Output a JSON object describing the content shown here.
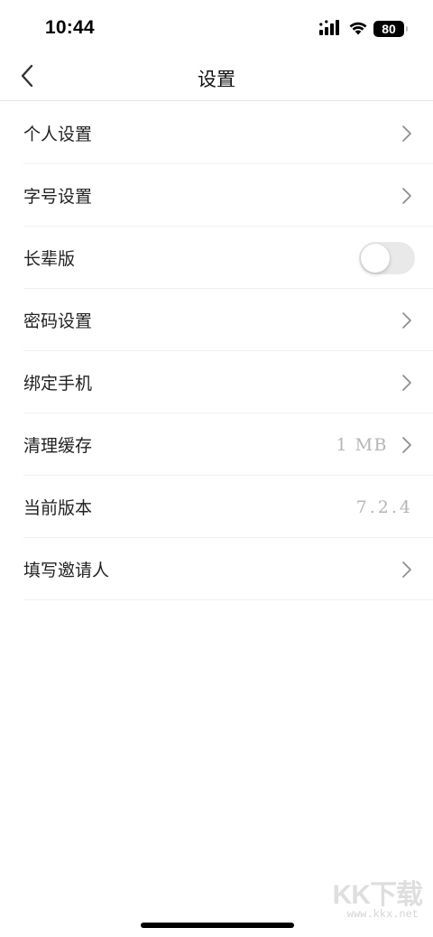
{
  "status_bar": {
    "time": "10:44",
    "battery_level": "80",
    "icons": [
      "cellular-signal-icon",
      "wifi-icon",
      "battery-icon"
    ]
  },
  "nav": {
    "title": "设置",
    "back_icon": "chevron-left-icon"
  },
  "settings": {
    "items": [
      {
        "label": "个人设置",
        "type": "link"
      },
      {
        "label": "字号设置",
        "type": "link"
      },
      {
        "label": "长辈版",
        "type": "toggle",
        "toggle_on": false
      },
      {
        "label": "密码设置",
        "type": "link"
      },
      {
        "label": "绑定手机",
        "type": "link"
      },
      {
        "label": "清理缓存",
        "type": "link",
        "value": "1 MB"
      },
      {
        "label": "当前版本",
        "type": "value",
        "value": "7.2.4"
      },
      {
        "label": "填写邀请人",
        "type": "link"
      }
    ]
  },
  "colors": {
    "background": "#ffffff",
    "text": "#222222",
    "secondary_text": "#b5b5b5",
    "toggle_off": "#e9e9ea",
    "divider": "#f0f0f0"
  },
  "watermark": {
    "logo": "KK下载",
    "url": "www.kkx.net"
  }
}
